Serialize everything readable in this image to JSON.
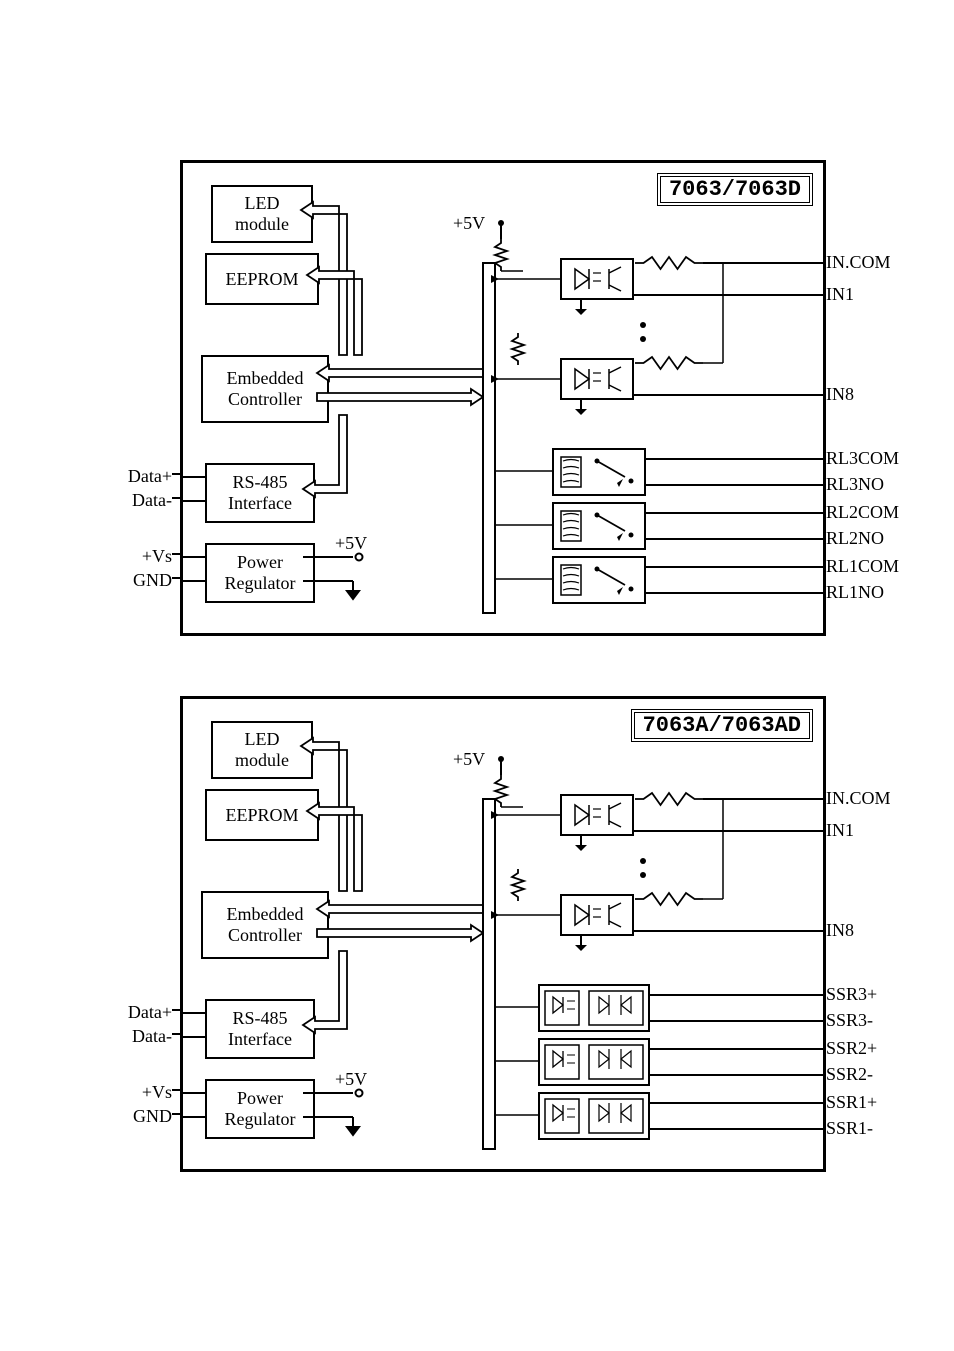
{
  "diagrams": [
    {
      "title": "7063/7063D",
      "blocks": {
        "led": "LED\nmodule",
        "eeprom": "EEPROM",
        "controller": "Embedded\nController",
        "rs485": "RS-485\nInterface",
        "power": "Power\nRegulator"
      },
      "voltage_5v": "+5V",
      "left_pins": {
        "data_plus": "Data+",
        "data_minus": "Data-",
        "vs": "+Vs",
        "gnd": "GND"
      },
      "right_pins": [
        "IN.COM",
        "IN1",
        "IN8",
        "RL3COM",
        "RL3NO",
        "RL2COM",
        "RL2NO",
        "RL1COM",
        "RL1NO"
      ],
      "output_type": "relay"
    },
    {
      "title": "7063A/7063AD",
      "blocks": {
        "led": "LED\nmodule",
        "eeprom": "EEPROM",
        "controller": "Embedded\nController",
        "rs485": "RS-485\nInterface",
        "power": "Power\nRegulator"
      },
      "voltage_5v": "+5V",
      "left_pins": {
        "data_plus": "Data+",
        "data_minus": "Data-",
        "vs": "+Vs",
        "gnd": "GND"
      },
      "right_pins": [
        "IN.COM",
        "IN1",
        "IN8",
        "SSR3+",
        "SSR3-",
        "SSR2+",
        "SSR2-",
        "SSR1+",
        "SSR1-"
      ],
      "output_type": "ssr"
    }
  ]
}
